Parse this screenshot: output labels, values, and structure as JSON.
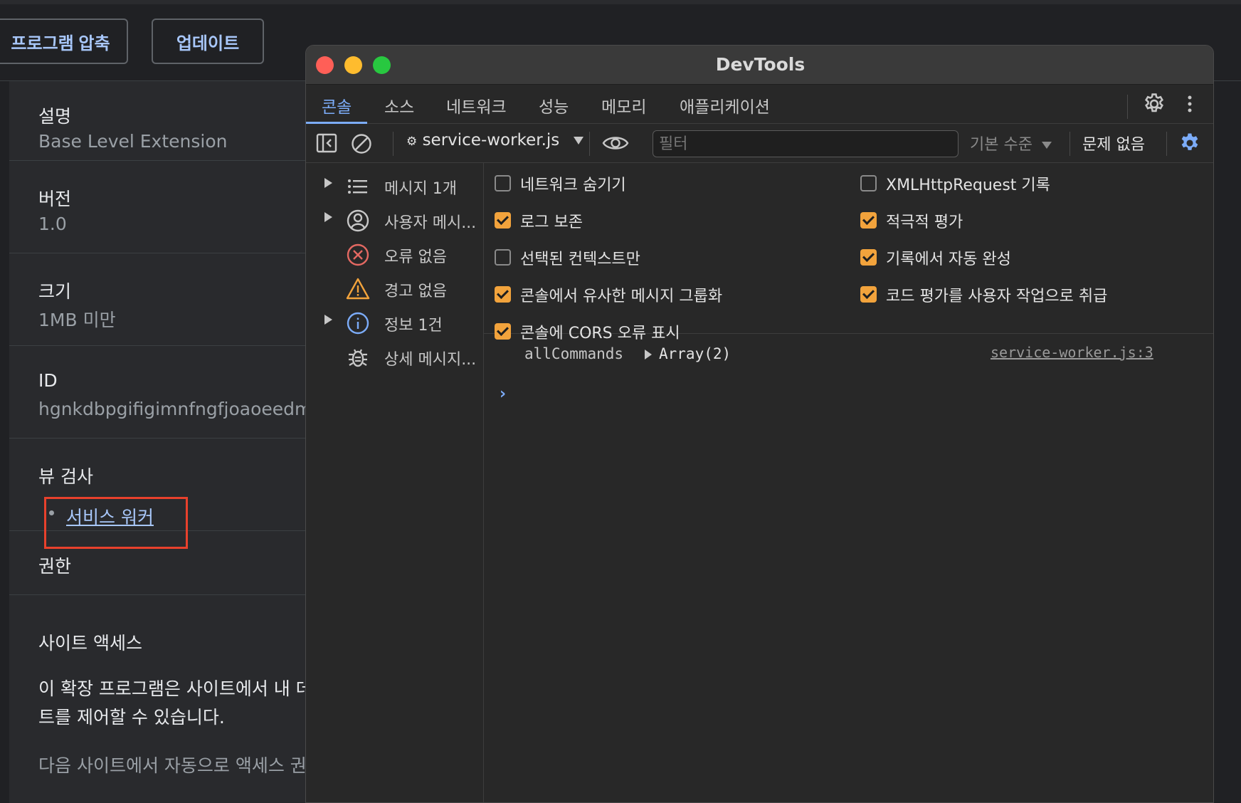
{
  "ext": {
    "compress_button": "프로그램 압축",
    "update_button": "업데이트",
    "description_label": "설명",
    "description_value": "Base Level Extension",
    "version_label": "버전",
    "version_value": "1.0",
    "size_label": "크기",
    "size_value": "1MB 미만",
    "id_label": "ID",
    "id_value": "hgnkdbpgifigimnfngfjoaoeedm",
    "inspect_label": "뷰 검사",
    "service_worker_link": "서비스 워커",
    "permissions_label": "권한",
    "site_access_label": "사이트 액세스",
    "site_access_text_1": "이 확장 프로그램은 사이트에서 내 데",
    "site_access_text_2": "트를 제어할 수 있습니다.",
    "auto_access_text": "다음 사이트에서 자동으로 액세스 권한"
  },
  "devtools": {
    "title": "DevTools",
    "tabs": [
      "콘솔",
      "소스",
      "네트워크",
      "성능",
      "메모리",
      "애플리케이션"
    ],
    "active_tab": "콘솔",
    "toolbar": {
      "context": "service-worker.js",
      "filter_placeholder": "필터",
      "level": "기본 수준",
      "issues": "문제 없음"
    },
    "sidebar": [
      {
        "label": "메시지 1개",
        "icon": "list-icon",
        "expandable": true
      },
      {
        "label": "사용자 메시...",
        "icon": "user-icon",
        "expandable": true
      },
      {
        "label": "오류 없음",
        "icon": "error-icon",
        "expandable": false
      },
      {
        "label": "경고 없음",
        "icon": "warning-icon",
        "expandable": false
      },
      {
        "label": "정보 1건",
        "icon": "info-icon",
        "expandable": true
      },
      {
        "label": "상세 메시지...",
        "icon": "bug-icon",
        "expandable": false
      }
    ],
    "settings_left": [
      {
        "label": "네트워크 숨기기",
        "checked": false
      },
      {
        "label": "로그 보존",
        "checked": true
      },
      {
        "label": "선택된 컨텍스트만",
        "checked": false
      },
      {
        "label": "콘솔에서 유사한 메시지 그룹화",
        "checked": true
      },
      {
        "label": "콘솔에 CORS 오류 표시",
        "checked": true
      }
    ],
    "settings_right": [
      {
        "label": "XMLHttpRequest 기록",
        "checked": false
      },
      {
        "label": "적극적 평가",
        "checked": true
      },
      {
        "label": "기록에서 자동 완성",
        "checked": true
      },
      {
        "label": "코드 평가를 사용자 작업으로 취급",
        "checked": true
      }
    ],
    "log": {
      "key": "allCommands",
      "value": "Array(2)",
      "source": "service-worker.js:3"
    },
    "prompt": "›"
  },
  "colors": {
    "accent": "#7cacf8",
    "checkbox": "#f2a33c",
    "highlight": "#e8412c",
    "link": "#a8c7fa"
  }
}
